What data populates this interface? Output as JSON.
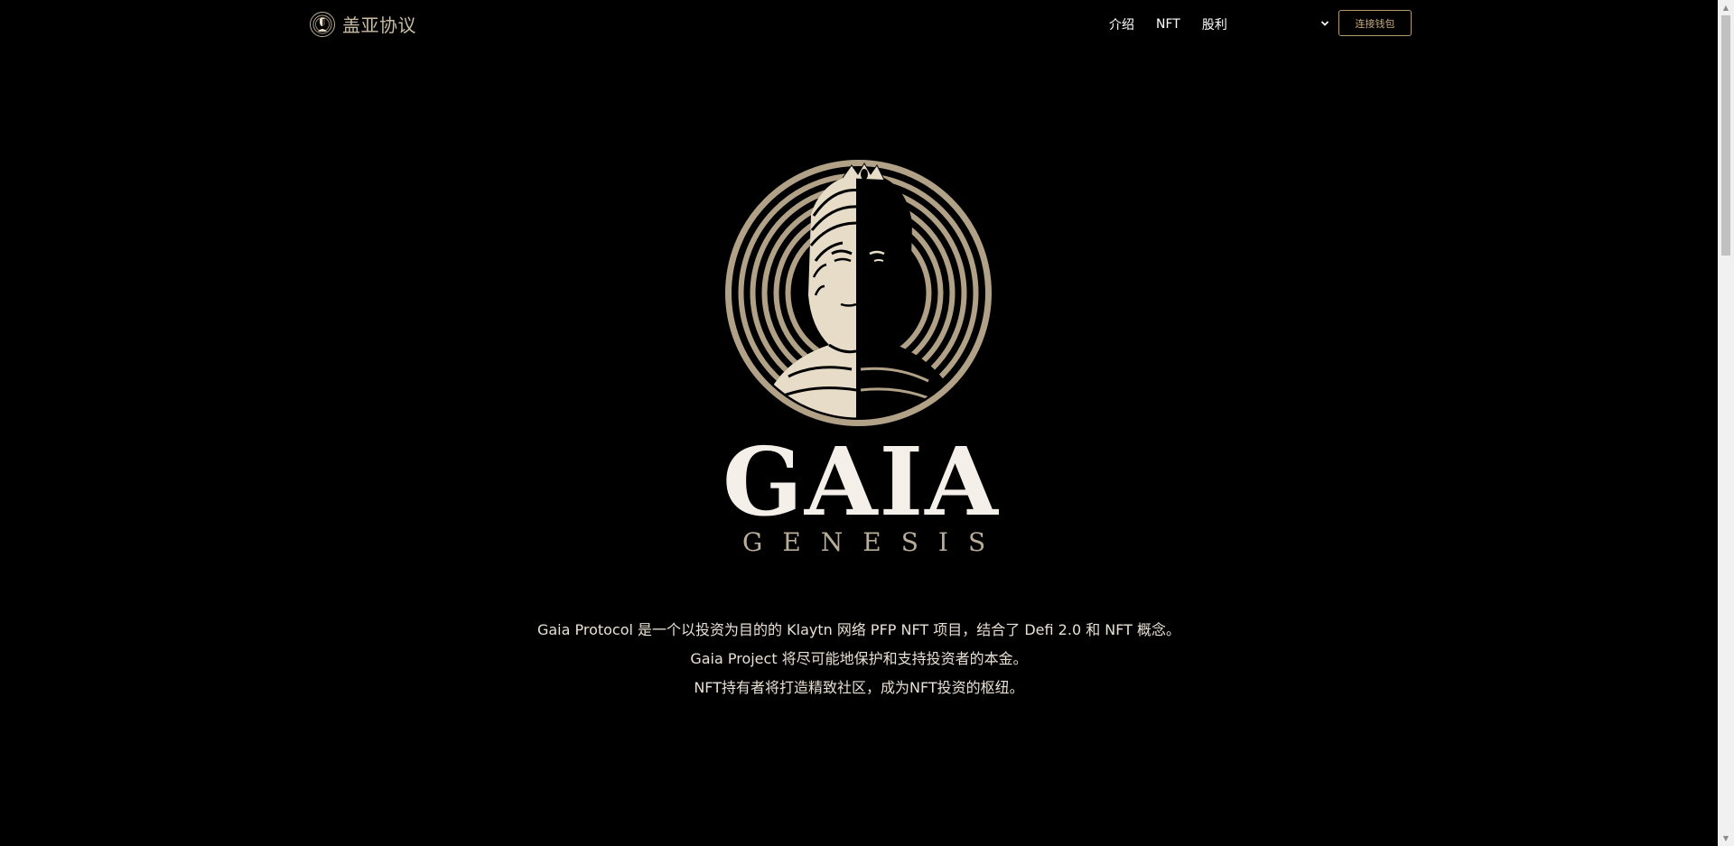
{
  "brand": {
    "name": "盖亚协议",
    "logo_icon": "goddess-emblem-icon"
  },
  "nav": {
    "links": [
      "介绍",
      "NFT",
      "股利"
    ],
    "language_select_value": "",
    "wallet_button_label": "连接钱包"
  },
  "hero": {
    "emblem_icon": "gaia-goddess-emblem",
    "title": "GAIA",
    "subtitle": "GENESIS",
    "description_lines": [
      "Gaia Protocol 是一个以投资为目的的 Klaytn 网络 PFP NFT 项目，结合了 Defi 2.0 和 NFT 概念。",
      "Gaia Project 将尽可能地保护和支持投资者的本金。",
      "NFT持有者将打造精致社区，成为NFT投资的枢纽。"
    ]
  },
  "colors": {
    "background": "#000000",
    "brand_gold": "#c9bca2",
    "button_border": "#b59a6b",
    "title_white": "#f4efe8",
    "emblem_tan": "#b1a186",
    "text": "#e8e0d4"
  }
}
